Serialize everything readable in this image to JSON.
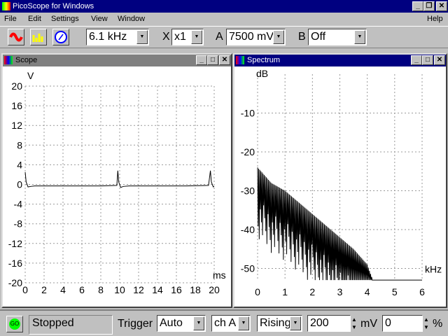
{
  "app": {
    "title": "PicoScope for Windows"
  },
  "menu": [
    "File",
    "Edit",
    "Settings",
    "View",
    "Window"
  ],
  "menu_help": "Help",
  "toolbar": {
    "sample_rate": "6.1 kHz",
    "x_label": "X",
    "x_zoom": "x1",
    "a_label": "A",
    "a_range": "7500 mV",
    "b_label": "B",
    "b_range": "Off"
  },
  "scope": {
    "title": "Scope",
    "y_unit": "V",
    "x_unit": "ms"
  },
  "spectrum": {
    "title": "Spectrum",
    "y_unit": "dB",
    "x_unit": "kHz"
  },
  "status": {
    "go": "GO",
    "state": "Stopped",
    "trigger_label": "Trigger",
    "trigger_mode": "Auto",
    "trigger_channel": "ch A",
    "trigger_edge": "Rising",
    "threshold": "200",
    "threshold_unit": "mV",
    "delay": "0",
    "delay_unit": "%"
  },
  "colors": {
    "title_active": "#000080",
    "title_inactive": "#808080",
    "go": "#00ff00"
  },
  "chart_data": [
    {
      "type": "line",
      "title": "Scope",
      "ylabel": "V",
      "xlabel": "ms",
      "xlim": [
        0,
        20
      ],
      "ylim": [
        -20,
        20
      ],
      "grid": true,
      "x_ticks": [
        "0",
        "2",
        "4",
        "6",
        "8",
        "10",
        "12",
        "14",
        "16",
        "18",
        "20"
      ],
      "y_ticks": [
        "20",
        "16",
        "12",
        "8",
        "4",
        "0",
        "-4",
        "-8",
        "-12",
        "-16",
        "-20"
      ],
      "x": [
        0,
        0.1,
        0.3,
        0.6,
        1,
        2,
        4,
        6,
        8,
        9.7,
        9.8,
        9.9,
        10.1,
        10.4,
        11,
        13,
        15,
        17,
        19.4,
        19.6,
        19.7,
        19.9,
        20
      ],
      "y": [
        2.5,
        0.5,
        -0.5,
        -0.4,
        -0.3,
        -0.3,
        -0.3,
        -0.3,
        -0.3,
        -0.2,
        2.8,
        0.5,
        -0.6,
        -0.4,
        -0.3,
        -0.3,
        -0.3,
        -0.3,
        -0.2,
        2.8,
        0.5,
        -0.5,
        -0.4
      ]
    },
    {
      "type": "line",
      "title": "Spectrum",
      "ylabel": "dB",
      "xlabel": "kHz",
      "xlim": [
        0,
        6
      ],
      "ylim": [
        -53,
        0
      ],
      "grid": true,
      "x_ticks": [
        "0",
        "1",
        "2",
        "3",
        "4",
        "5",
        "6"
      ],
      "y_ticks": [
        "-10",
        "-20",
        "-30",
        "-40",
        "-50"
      ],
      "envelope_x": [
        0,
        0.5,
        1,
        1.5,
        2,
        2.5,
        3,
        3.5,
        4,
        4.2,
        6
      ],
      "envelope_db": [
        -24,
        -28,
        -30,
        -33,
        -36,
        -39,
        -42,
        -45,
        -49,
        -53,
        -53
      ]
    }
  ]
}
